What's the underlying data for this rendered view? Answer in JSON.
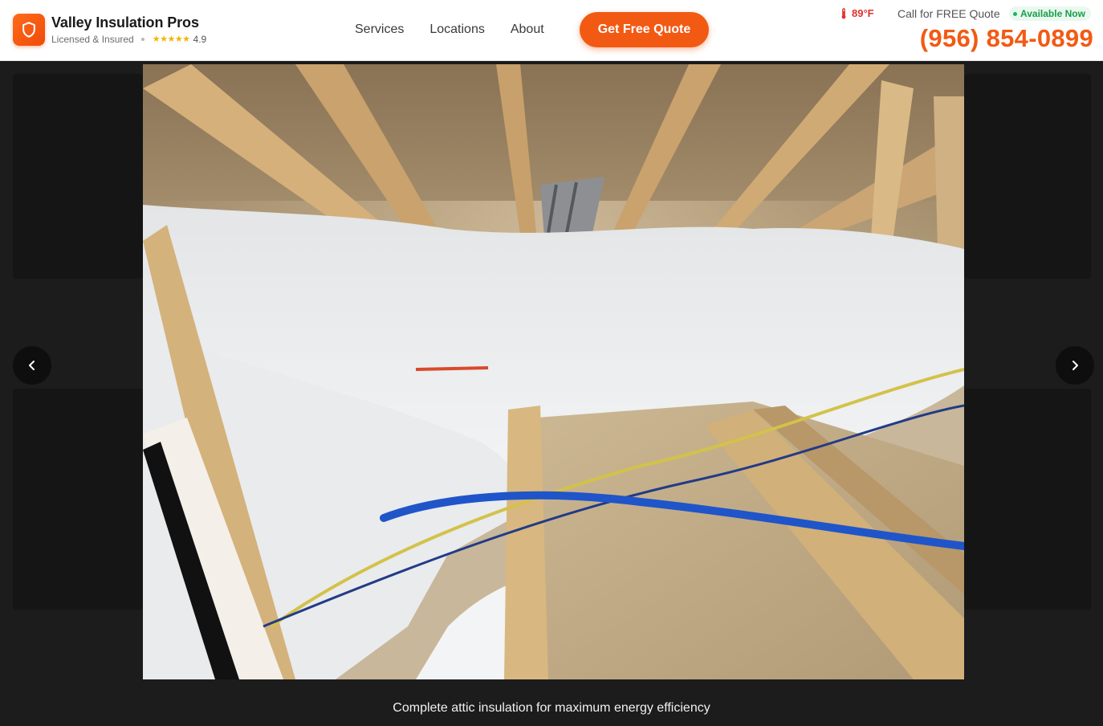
{
  "brand": {
    "name": "Valley Insulation Pros",
    "tagline": "Licensed & Insured",
    "stars": "★★★★★",
    "rating": "4.9",
    "logo_icon": "shield-icon",
    "accent_color": "#f25a14"
  },
  "nav": {
    "items": [
      "Services",
      "Locations",
      "About"
    ]
  },
  "cta": {
    "quote_label": "Get Free Quote"
  },
  "contact": {
    "temperature": "89°F",
    "temperature_icon": "thermometer-icon",
    "call_label": "Call for FREE Quote",
    "availability": "Available Now",
    "phone": "(956) 854-0899"
  },
  "gallery": {
    "caption": "Complete attic insulation for maximum energy efficiency",
    "prev_icon": "chevron-left-icon",
    "next_icon": "chevron-right-icon"
  }
}
